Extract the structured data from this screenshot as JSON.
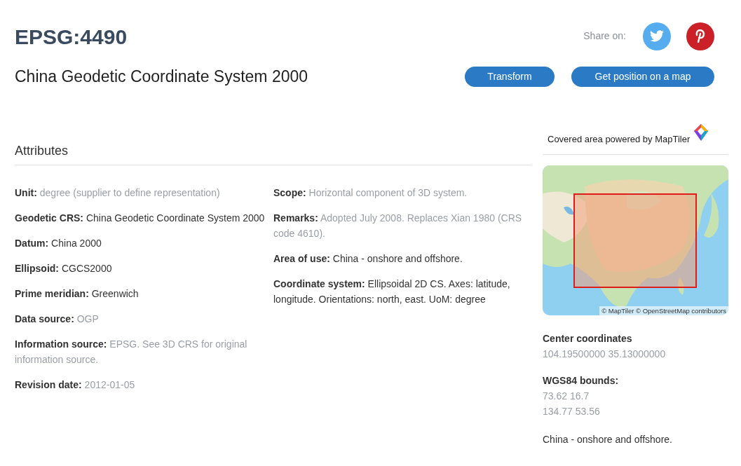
{
  "title": "EPSG:4490",
  "subtitle": "China Geodetic Coordinate System 2000",
  "share": {
    "label": "Share on:",
    "buttons": [
      {
        "kind": "twitter"
      },
      {
        "kind": "pinterest"
      }
    ]
  },
  "actions": [
    "Transform",
    "Get position on a map"
  ],
  "attributes": {
    "heading": "Attributes",
    "column_1": [
      {
        "label": "Unit:",
        "value": "degree (supplier to define representation)",
        "muted": true
      },
      {
        "label": "Geodetic CRS:",
        "value": "China Geodetic Coordinate System 2000",
        "muted": false
      },
      {
        "label": "Datum:",
        "value": "China 2000",
        "muted": false
      },
      {
        "label": "Ellipsoid:",
        "value": "CGCS2000",
        "muted": false
      },
      {
        "label": "Prime meridian:",
        "value": "Greenwich",
        "muted": false
      },
      {
        "label": "Data source:",
        "value": "OGP",
        "muted": true
      },
      {
        "label": "Information source:",
        "value": "EPSG. See 3D CRS for original information source.",
        "muted": true
      },
      {
        "label": "Revision date:",
        "value": "2012-01-05",
        "muted": true
      }
    ],
    "column_2": [
      {
        "label": "Scope:",
        "value": "Horizontal component of 3D system.",
        "muted": true
      },
      {
        "label": "Remarks:",
        "value": "Adopted July 2008. Replaces Xian 1980 (CRS code 4610).",
        "muted": true
      },
      {
        "label": "Area of use:",
        "value": "China - onshore and offshore.",
        "muted": false
      },
      {
        "label": "Coordinate system:",
        "value": "Ellipsoidal 2D CS. Axes: latitude, longitude. Orientations: north, east. UoM: degree",
        "muted": false
      }
    ]
  },
  "sidebar": {
    "map_heading": "Covered area powered by MapTiler",
    "map": {
      "attribution": "© MapTiler © OpenStreetMap contributors"
    },
    "sections": [
      {
        "heading": "Center coordinates",
        "lines": [
          "104.19500000 35.13000000"
        ]
      },
      {
        "heading": "WGS84 bounds:",
        "lines": [
          "73.62 16.7",
          "134.77 53.56"
        ]
      }
    ],
    "area": "China - onshore and offshore."
  }
}
